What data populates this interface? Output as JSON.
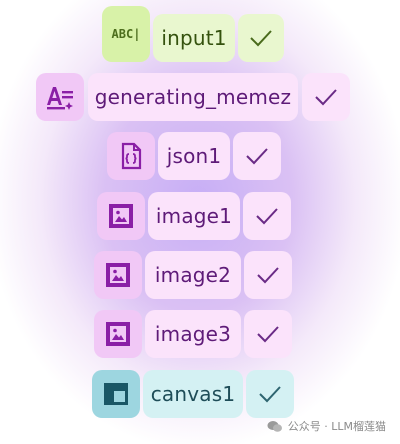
{
  "nodes": [
    {
      "label": "input1",
      "icon": "text-input-icon",
      "icon_text": "ABC|",
      "theme": "green"
    },
    {
      "label": "generating_memez",
      "icon": "text-generation-icon",
      "theme": "purple"
    },
    {
      "label": "json1",
      "icon": "json-file-icon",
      "theme": "purple"
    },
    {
      "label": "image1",
      "icon": "image-icon",
      "theme": "purple"
    },
    {
      "label": "image2",
      "icon": "image-icon",
      "theme": "purple"
    },
    {
      "label": "image3",
      "icon": "image-icon",
      "theme": "purple"
    },
    {
      "label": "canvas1",
      "icon": "canvas-layout-icon",
      "theme": "teal"
    }
  ],
  "watermark": "公众号 · LLM榴莲猫",
  "colors": {
    "purple_chip": "#f1c8f6",
    "purple_pill": "#fbe3fb",
    "green_chip": "#d8f2a8",
    "green_pill": "#e9f7cf",
    "teal_chip": "#9dd6e0",
    "teal_pill": "#d4f1f3",
    "icon_purple": "#8a1fa6"
  }
}
